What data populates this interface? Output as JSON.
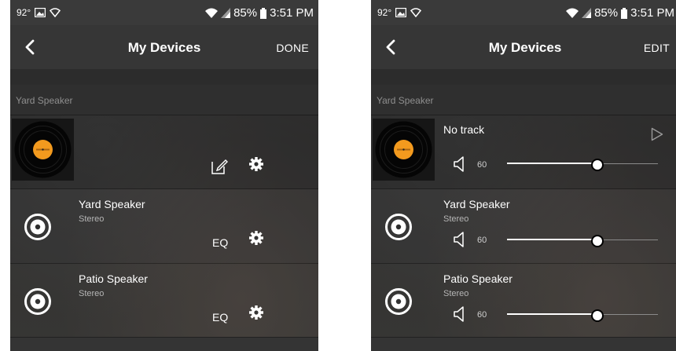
{
  "status_bar": {
    "temperature": "92°",
    "battery": "85%",
    "time": "3:51 PM"
  },
  "left_screen": {
    "title": "My Devices",
    "action_label": "DONE",
    "section_label": "Yard Speaker",
    "devices": [
      {
        "name": "Yard Speaker",
        "subtitle": "Stereo",
        "eq_label": "EQ"
      },
      {
        "name": "Patio Speaker",
        "subtitle": "Stereo",
        "eq_label": "EQ"
      }
    ]
  },
  "right_screen": {
    "title": "My Devices",
    "action_label": "EDIT",
    "section_label": "Yard Speaker",
    "now_playing": {
      "track": "No track",
      "volume": "60",
      "volume_level": 0.6
    },
    "devices": [
      {
        "name": "Yard Speaker",
        "subtitle": "Stereo",
        "volume": "60",
        "volume_level": 0.6
      },
      {
        "name": "Patio Speaker",
        "subtitle": "Stereo",
        "volume": "60",
        "volume_level": 0.6
      }
    ]
  },
  "colors": {
    "background": "#333333",
    "text": "#ffffff",
    "section_label": "#8f8f8f",
    "album_label": "#f39a1e"
  },
  "icons": [
    "back-arrow-icon",
    "edit-icon",
    "gear-icon",
    "play-icon",
    "volume-icon",
    "speaker-icon",
    "vinyl-record-icon",
    "wifi-icon",
    "signal-icon",
    "battery-icon",
    "image-icon"
  ]
}
